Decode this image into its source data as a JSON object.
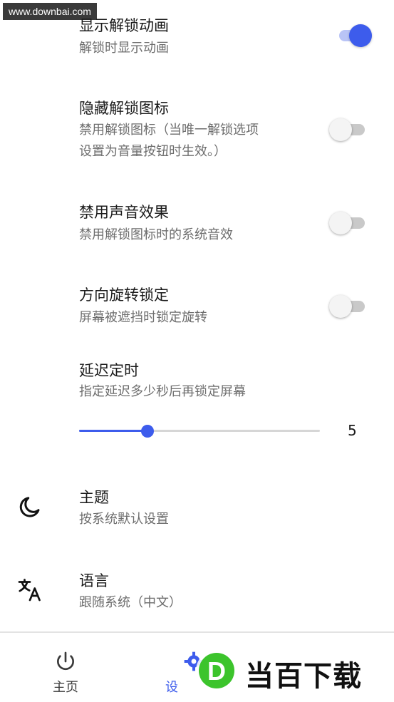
{
  "watermark": {
    "text": "www.downbai.com"
  },
  "settings": {
    "show_anim": {
      "title": "显示解锁动画",
      "subtitle": "解锁时显示动画",
      "enabled": true
    },
    "hide_icon": {
      "title": "隐藏解锁图标",
      "subtitle_line1": "禁用解锁图标（当唯一解锁选项",
      "subtitle_line2": "设置为音量按钮时生效。）",
      "enabled": false
    },
    "disable_sound": {
      "title": "禁用声音效果",
      "subtitle": "禁用解锁图标时的系统音效",
      "enabled": false
    },
    "rotation_lock": {
      "title": "方向旋转锁定",
      "subtitle": "屏幕被遮挡时锁定旋转",
      "enabled": false
    },
    "delay_timer": {
      "title": "延迟定时",
      "subtitle": "指定延迟多少秒后再锁定屏幕",
      "value": "5",
      "slider_fraction": 0.285
    },
    "theme": {
      "title": "主题",
      "subtitle": "按系统默认设置",
      "icon": "moon-icon"
    },
    "language": {
      "title": "语言",
      "subtitle": "跟随系统（中文）",
      "icon": "translate-icon"
    }
  },
  "bottom_nav": {
    "home": {
      "label": "主页",
      "icon": "power-icon"
    },
    "settings": {
      "label": "设",
      "icon": "gear-icon"
    }
  },
  "brand": {
    "text": "当百下载",
    "letter": "D"
  },
  "colors": {
    "accent": "#3d5cec",
    "accent_light": "#b9c4f6",
    "text_secondary": "#6d6d6d",
    "brand_green": "#3cc42c"
  }
}
